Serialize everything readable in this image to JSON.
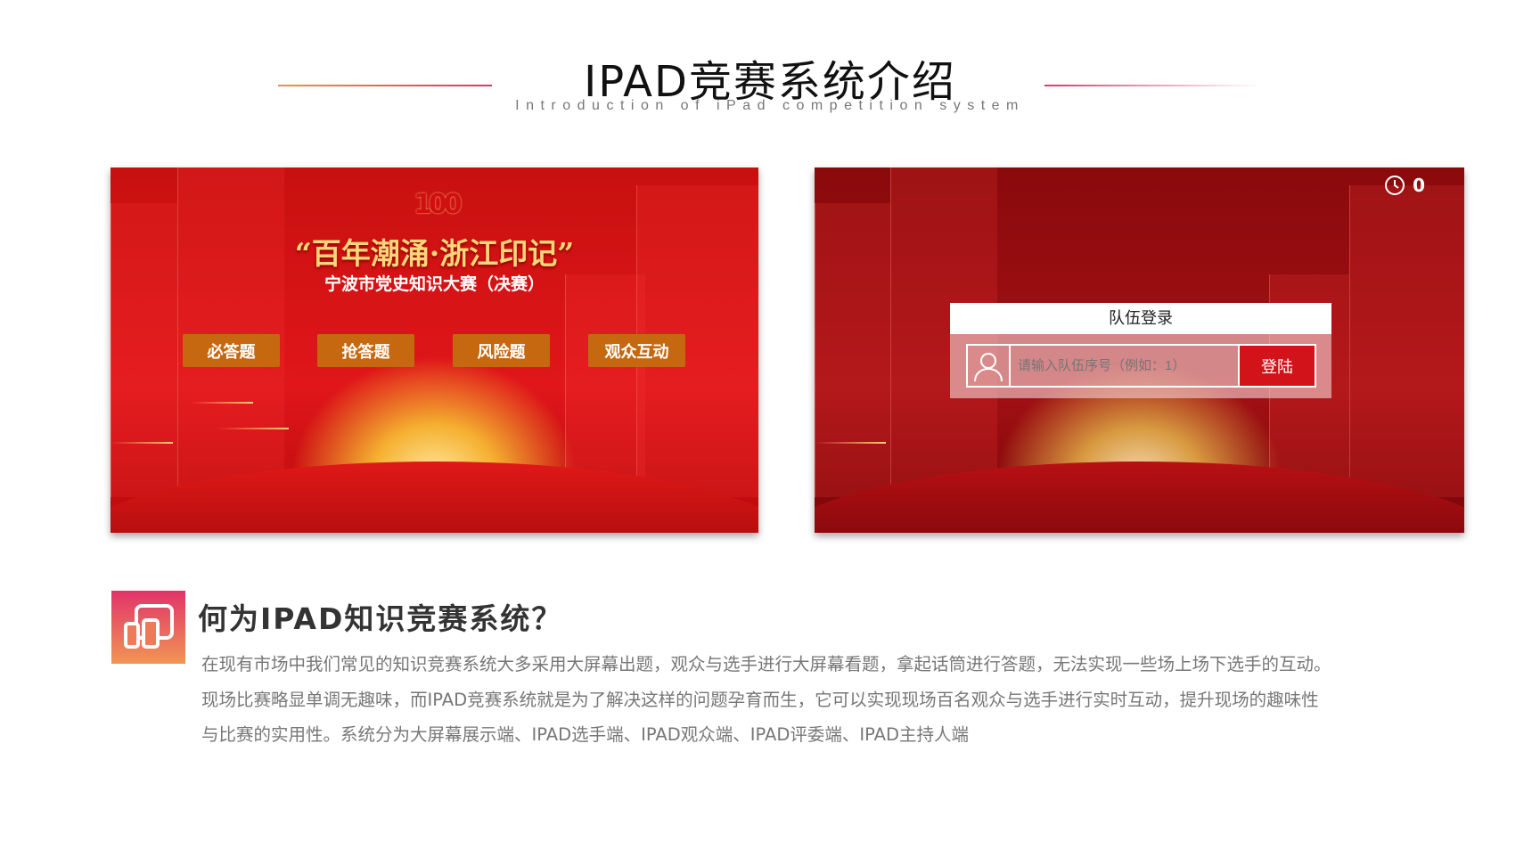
{
  "header": {
    "title": "IPAD竞赛系统介绍",
    "subtitle": "Introduction of iPad competition system"
  },
  "screen_left": {
    "logo_text": "100",
    "title": "“百年潮涌·浙江印记”",
    "subtitle": "宁波市党史知识大赛（决赛）",
    "buttons": [
      "必答题",
      "抢答题",
      "风险题",
      "观众互动"
    ]
  },
  "screen_right": {
    "timer_value": "0",
    "login_title": "队伍登录",
    "input_placeholder": "请输入队伍序号（例如：1）",
    "login_button": "登陆"
  },
  "section": {
    "icon": "devices-icon",
    "heading": "何为IPAD知识竞赛系统？",
    "lines": [
      "在现有市场中我们常见的知识竞赛系统大多采用大屏幕出题，观众与选手进行大屏幕看题，拿起话筒进行答题，无法实现一些场上场下选手的互动。",
      "现场比赛略显单调无趣味，而IPAD竞赛系统就是为了解决这样的问题孕育而生，它可以实现现场百名观众与选手进行实时互动，提升现场的趣味性",
      "与比赛的实用性。系统分为大屏幕展示端、IPAD选手端、IPAD观众端、IPAD评委端、IPAD主持人端"
    ]
  },
  "colors": {
    "accent_start": "#e2336a",
    "accent_end": "#f19553",
    "button_orange": "#c5680f",
    "login_red": "#d2141a"
  }
}
